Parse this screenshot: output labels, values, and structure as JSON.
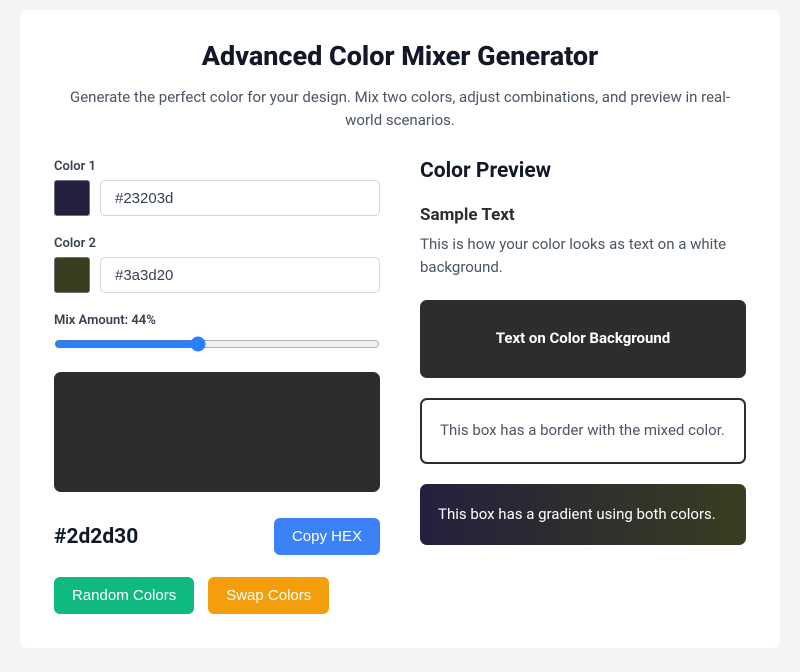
{
  "header": {
    "title": "Advanced Color Mixer Generator",
    "subtitle": "Generate the perfect color for your design. Mix two colors, adjust combinations, and preview in real-world scenarios."
  },
  "color1": {
    "label": "Color 1",
    "value": "#23203d",
    "swatch": "#23203d"
  },
  "color2": {
    "label": "Color 2",
    "value": "#3a3d20",
    "swatch": "#3a3d20"
  },
  "mix": {
    "label": "Mix Amount: 44%",
    "percent": 44
  },
  "result": {
    "hex": "#2d2d30",
    "swatch": "#2d2d30"
  },
  "buttons": {
    "copy": "Copy HEX",
    "random": "Random Colors",
    "swap": "Swap Colors"
  },
  "preview": {
    "heading": "Color Preview",
    "sample_title": "Sample Text",
    "sample_desc": "This is how your color looks as text on a white background.",
    "on_color_text": "Text on Color Background",
    "border_text": "This box has a border with the mixed color.",
    "gradient_text": "This box has a gradient using both colors."
  },
  "colors": {
    "accent_blue": "#3b82f6",
    "accent_green": "#10b981",
    "accent_yellow": "#f59e0b"
  }
}
